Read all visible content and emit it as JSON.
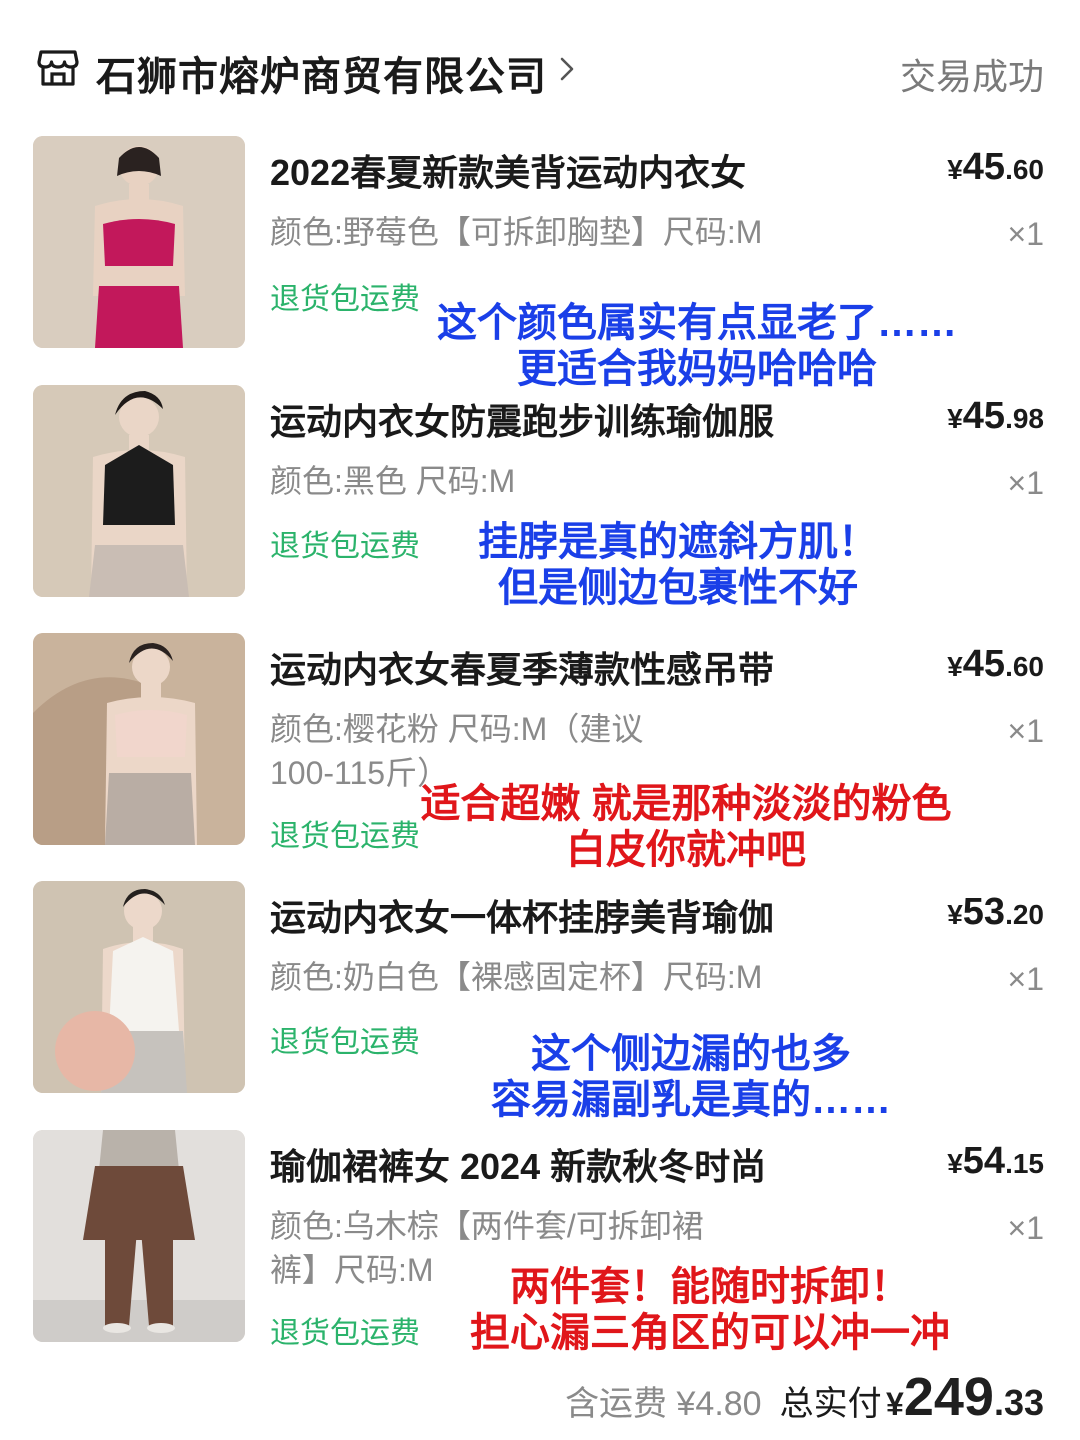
{
  "store": {
    "name": "石狮市熔炉商贸有限公司",
    "status": "交易成功"
  },
  "items": [
    {
      "title": "2022春夏新款美背运动内衣女",
      "price_currency": "¥",
      "price_int": "45",
      "price_dec": ".60",
      "spec": "颜色:野莓色【可拆卸胸垫】尺码:M",
      "qty": "×1",
      "tag": "退货包运费",
      "note_line1": "这个颜色属实有点显老了……",
      "note_line2": "更适合我妈妈哈哈哈",
      "top_color": "#c2185b",
      "bottom_color": "#c2185b"
    },
    {
      "title": "运动内衣女防震跑步训练瑜伽服",
      "price_currency": "¥",
      "price_int": "45",
      "price_dec": ".98",
      "spec": "颜色:黑色 尺码:M",
      "qty": "×1",
      "tag": "退货包运费",
      "note_line1": "挂脖是真的遮斜方肌！",
      "note_line2": "但是侧边包裹性不好",
      "top_color": "#1c1c1c",
      "bottom_color": "#c9bdb4"
    },
    {
      "title": "运动内衣女春夏季薄款性感吊带",
      "price_currency": "¥",
      "price_int": "45",
      "price_dec": ".60",
      "spec": "颜色:樱花粉 尺码:M（建议100-115斤）",
      "qty": "×1",
      "tag": "退货包运费",
      "note_line1": "适合超嫩 就是那种淡淡的粉色",
      "note_line2": "白皮你就冲吧",
      "top_color": "#f1d6cc",
      "bottom_color": "#b9ada4"
    },
    {
      "title": "运动内衣女一体杯挂脖美背瑜伽",
      "price_currency": "¥",
      "price_int": "53",
      "price_dec": ".20",
      "spec": "颜色:奶白色【裸感固定杯】尺码:M",
      "qty": "×1",
      "tag": "退货包运费",
      "note_line1": "这个侧边漏的也多",
      "note_line2": "容易漏副乳是真的……",
      "top_color": "#f5f3ef",
      "bottom_color": "#c6c2bd"
    },
    {
      "title": "瑜伽裙裤女 2024 新款秋冬时尚",
      "price_currency": "¥",
      "price_int": "54",
      "price_dec": ".15",
      "spec": "颜色:乌木棕【两件套/可拆卸裙裤】尺码:M",
      "qty": "×1",
      "tag": "退货包运费",
      "note_line1": "两件套！能随时拆卸！",
      "note_line2": "担心漏三角区的可以冲一冲",
      "top_color": "#b9b2aa",
      "bottom_color": "#6e4a3a"
    }
  ],
  "summary": {
    "shipping": "含运费 ¥4.80",
    "total_label": "总实付",
    "total_currency": "¥",
    "total_int": "249",
    "total_dec": ".33"
  },
  "colors": {
    "tag_green": "#2bb36b",
    "note_blue": "#1a3fe8",
    "note_red": "#e0161a"
  }
}
